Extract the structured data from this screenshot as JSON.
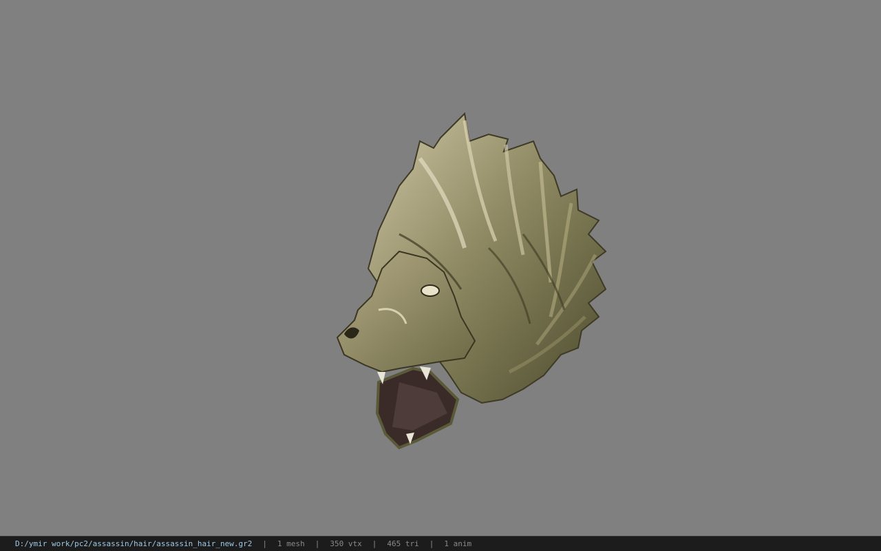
{
  "viewer": {
    "background_color": "#808080",
    "model_subject": "lion-head-hair-mesh"
  },
  "status_bar": {
    "file_path": "D:/ymir work/pc2/assassin/hair/assassin_hair_new.gr2",
    "separator": "|",
    "mesh_count": "1 mesh",
    "vertex_count": "350 vtx",
    "triangle_count": "465 tri",
    "anim_count": "1 anim",
    "path_color": "#9ec9e6",
    "stat_color": "#8a8a8a"
  }
}
